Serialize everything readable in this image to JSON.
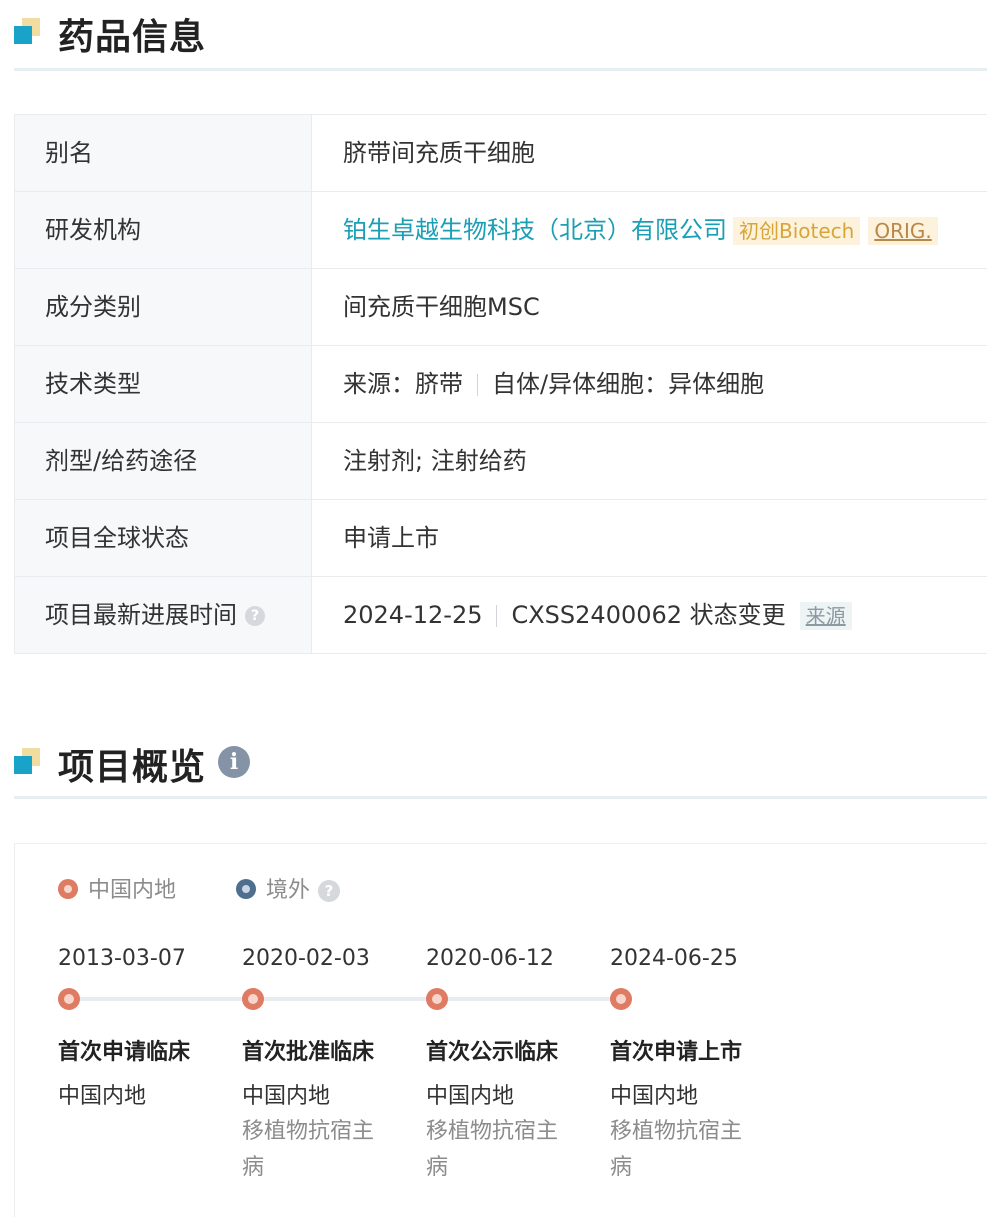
{
  "drug_info": {
    "title": "药品信息",
    "rows": [
      {
        "label": "别名",
        "value": "脐带间充质干细胞"
      },
      {
        "label": "研发机构",
        "value": "铂生卓越生物科技（北京）有限公司",
        "tag1": "初创Biotech",
        "tag2": "ORIG."
      },
      {
        "label": "成分类别",
        "value": "间充质干细胞MSC"
      },
      {
        "label": "技术类型",
        "value_a": "来源：脐带",
        "value_b": "自体/异体细胞：异体细胞"
      },
      {
        "label": "剂型/给药途径",
        "value": "注射剂; 注射给药"
      },
      {
        "label": "项目全球状态",
        "value": "申请上市"
      },
      {
        "label": "项目最新进展时间",
        "help": "?",
        "value_a": "2024-12-25",
        "value_b": "CXSS2400062 状态变更",
        "source": "来源"
      }
    ]
  },
  "overview": {
    "title": "项目概览",
    "info_icon": "i",
    "legend": [
      {
        "label": "中国内地",
        "color": "#df7a63"
      },
      {
        "label": "境外",
        "color": "#4f6f8f",
        "help": "?"
      }
    ],
    "timeline": [
      {
        "date": "2013-03-07",
        "event": "首次申请临床",
        "region": "中国内地",
        "indication": ""
      },
      {
        "date": "2020-02-03",
        "event": "首次批准临床",
        "region": "中国内地",
        "indication": "移植物抗宿主病"
      },
      {
        "date": "2020-06-12",
        "event": "首次公示临床",
        "region": "中国内地",
        "indication": "移植物抗宿主病"
      },
      {
        "date": "2024-06-25",
        "event": "首次申请上市",
        "region": "中国内地",
        "indication": "移植物抗宿主病"
      }
    ]
  }
}
